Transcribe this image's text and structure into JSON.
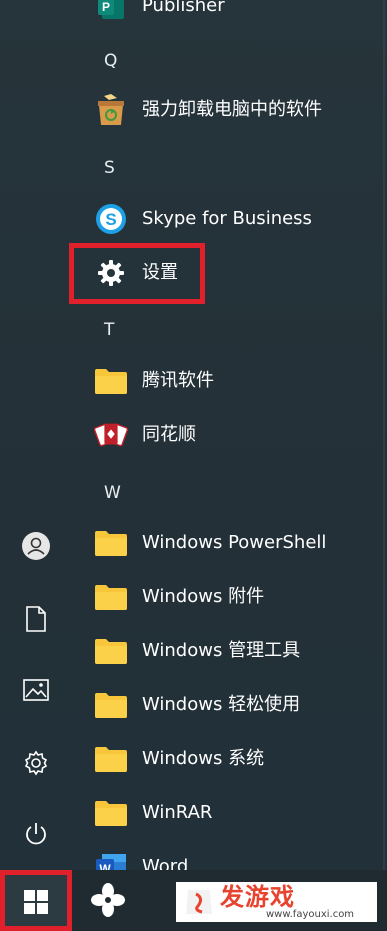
{
  "start_menu": {
    "letters": {
      "q": "Q",
      "s": "S",
      "t": "T",
      "w": "W"
    },
    "apps": {
      "publisher": "Publisher",
      "uninstaller": "强力卸载电脑中的软件",
      "skype": "Skype for Business",
      "settings": "设置",
      "tencent": "腾讯软件",
      "tonghuashun": "同花顺",
      "powershell": "Windows PowerShell",
      "accessories": "Windows 附件",
      "admin_tools": "Windows 管理工具",
      "ease_of_access": "Windows 轻松使用",
      "system": "Windows 系统",
      "winrar": "WinRAR",
      "word": "Word"
    }
  },
  "sidebar": {
    "icons": [
      "user-avatar-icon",
      "document-icon",
      "pictures-icon",
      "settings-gear-icon",
      "power-icon"
    ]
  },
  "taskbar": {
    "start_icon": "windows-logo-icon",
    "pinned_app_icon": "pinwheel-app-icon"
  },
  "watermark": {
    "title": "发游戏",
    "url": "www.fayouxi.com"
  },
  "colors": {
    "highlight": "#e0202a",
    "folder": "#f8c63a",
    "background": "#243036"
  }
}
